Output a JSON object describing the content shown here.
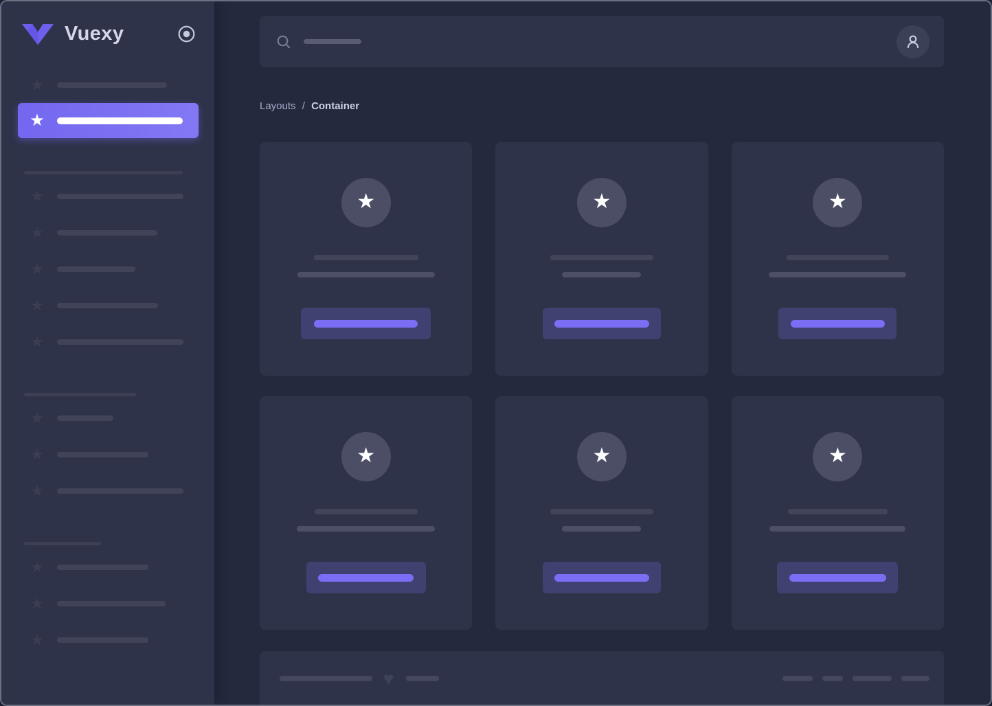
{
  "app": {
    "brand": "Vuexy"
  },
  "icons": {
    "star": "★",
    "heart": "♥"
  },
  "colors": {
    "accent": "#7367f0",
    "panel": "#2e3349",
    "background": "#242a3e",
    "button_fill": "#3f4270",
    "button_bar": "#7c6ef4"
  },
  "breadcrumb": {
    "section": "Layouts",
    "separator": "/",
    "current": "Container"
  },
  "search": {
    "bar": "width:84px"
  },
  "sidebar": {
    "top_item": {
      "bar": "width:160px"
    },
    "active_item": {
      "bar": "width:183px"
    },
    "sections": [
      {
        "header": "width:231px",
        "items": [
          {
            "bar": "width:184px"
          },
          {
            "bar": "width:146px"
          },
          {
            "bar": "width:114px"
          },
          {
            "bar": "width:147px"
          },
          {
            "bar": "width:184px"
          }
        ]
      },
      {
        "header": "width:163px",
        "items": [
          {
            "bar": "width:82px"
          },
          {
            "bar": "width:133px"
          },
          {
            "bar": "width:184px"
          }
        ]
      },
      {
        "header": "width:112px",
        "items": [
          {
            "bar": "width:133px"
          },
          {
            "bar": "width:158px"
          },
          {
            "bar": "width:133px"
          }
        ]
      }
    ]
  },
  "cards": [
    {
      "line1": "width:152px",
      "line2": "width:200px",
      "button": "width:189px"
    },
    {
      "line1": "width:150px",
      "line2": "width:115px",
      "button": "width:172px"
    },
    {
      "line1": "width:149px",
      "line2": "width:200px",
      "button": "width:172px"
    },
    {
      "line1": "width:150px",
      "line2": "width:201px",
      "button": "width:174px"
    },
    {
      "line1": "width:150px",
      "line2": "width:115px",
      "button": "width:172px"
    },
    {
      "line1": "width:145px",
      "line2": "width:198px",
      "button": "width:176px"
    }
  ],
  "footer": {
    "left_bar1": "width:135px",
    "left_bar2": "width:48px",
    "right_bars": [
      {
        "w": "width:44px"
      },
      {
        "w": "width:30px"
      },
      {
        "w": "width:57px"
      },
      {
        "w": "width:41px"
      }
    ]
  }
}
